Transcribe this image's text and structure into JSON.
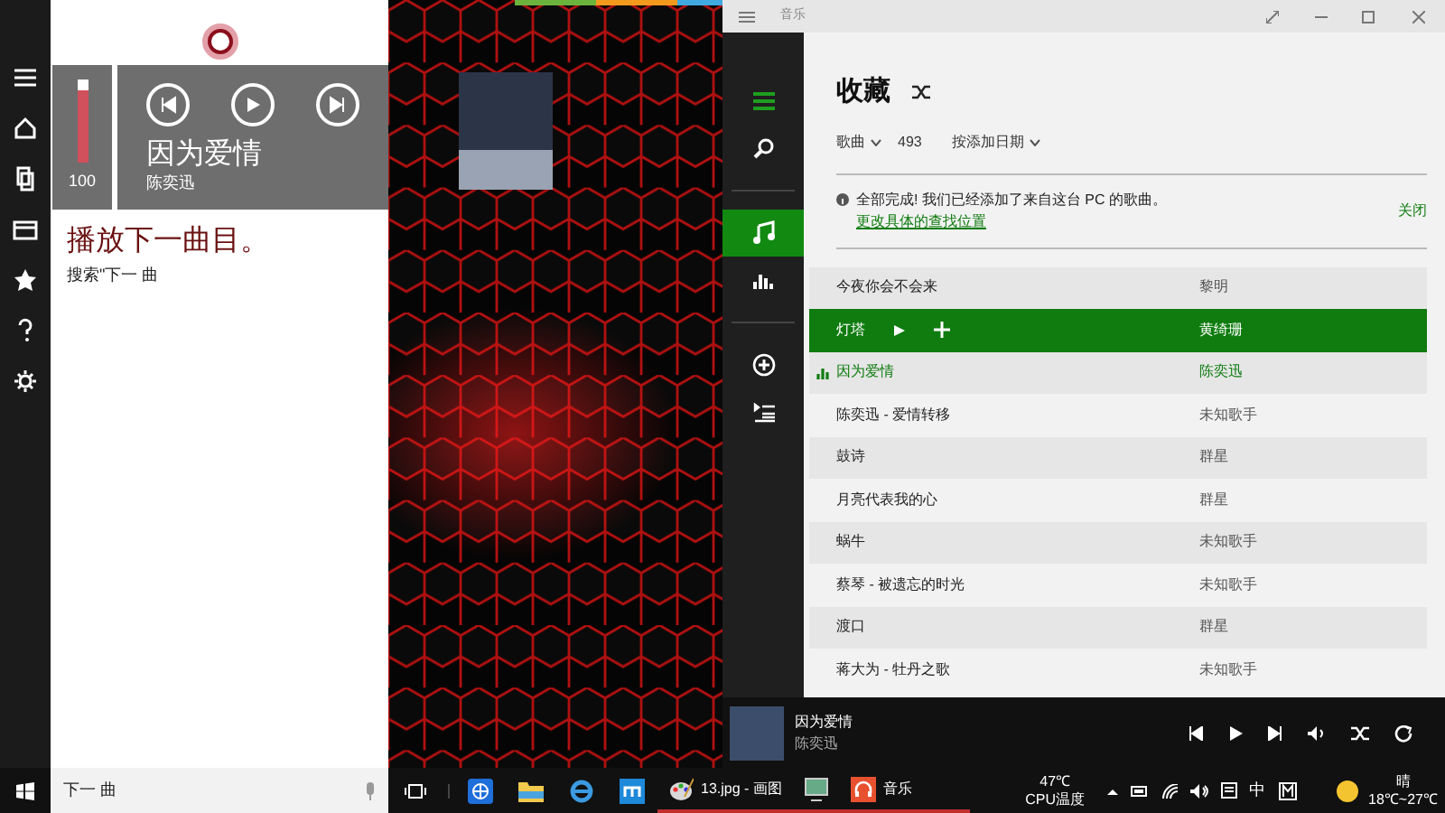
{
  "cortana": {
    "prompt": "播放下一曲目。",
    "hint": "搜索\"下一 曲",
    "volume": {
      "reading": "100",
      "level": 1
    },
    "card": {
      "title": "因为爱情",
      "artist": "陈奕迅"
    }
  },
  "music_app": {
    "window": {
      "title": "音乐"
    },
    "nav": [
      {
        "kind": "menu",
        "selected": false
      },
      {
        "kind": "search",
        "selected": false
      },
      {
        "kind": "music",
        "selected": true
      },
      {
        "kind": "chart",
        "selected": false
      },
      {
        "kind": "add",
        "selected": false
      },
      {
        "kind": "queue",
        "selected": false
      }
    ],
    "heading": "收藏",
    "filters": {
      "type": "歌曲",
      "count": "493",
      "sort": "按添加日期"
    },
    "notice": {
      "message": "全部完成! 我们已经添加了来自这台 PC 的歌曲。",
      "link": "更改具体的查找位置",
      "dismiss": "关闭"
    },
    "songs": [
      {
        "title": "今夜你会不会来",
        "artist": "黎明",
        "selected": false,
        "playing": false
      },
      {
        "title": "灯塔",
        "artist": "黄绮珊",
        "selected": true,
        "playing": false
      },
      {
        "title": "因为爱情",
        "artist": "陈奕迅",
        "selected": false,
        "playing": true
      },
      {
        "title": "陈奕迅 - 爱情转移",
        "artist": "未知歌手",
        "selected": false,
        "playing": false
      },
      {
        "title": "鼓诗",
        "artist": "群星",
        "selected": false,
        "playing": false
      },
      {
        "title": "月亮代表我的心",
        "artist": "群星",
        "selected": false,
        "playing": false
      },
      {
        "title": "蜗牛",
        "artist": "未知歌手",
        "selected": false,
        "playing": false
      },
      {
        "title": "蔡琴 - 被遗忘的时光",
        "artist": "未知歌手",
        "selected": false,
        "playing": false
      },
      {
        "title": "渡口",
        "artist": "群星",
        "selected": false,
        "playing": false
      },
      {
        "title": "蒋大为 - 牡丹之歌",
        "artist": "未知歌手",
        "selected": false,
        "playing": false
      }
    ],
    "now_playing": {
      "title": "因为爱情",
      "artist": "陈奕迅"
    }
  },
  "taskbar": {
    "search": "下一 曲",
    "apps": [
      {
        "kind": "paint",
        "label": "13.jpg - 画图"
      },
      {
        "kind": "monitor"
      },
      {
        "kind": "music",
        "label": "音乐"
      }
    ],
    "cpu": {
      "temp": "47℃",
      "label": "CPU温度"
    },
    "ime": "中",
    "weather": {
      "condition": "晴",
      "range": "18℃~27℃"
    }
  }
}
